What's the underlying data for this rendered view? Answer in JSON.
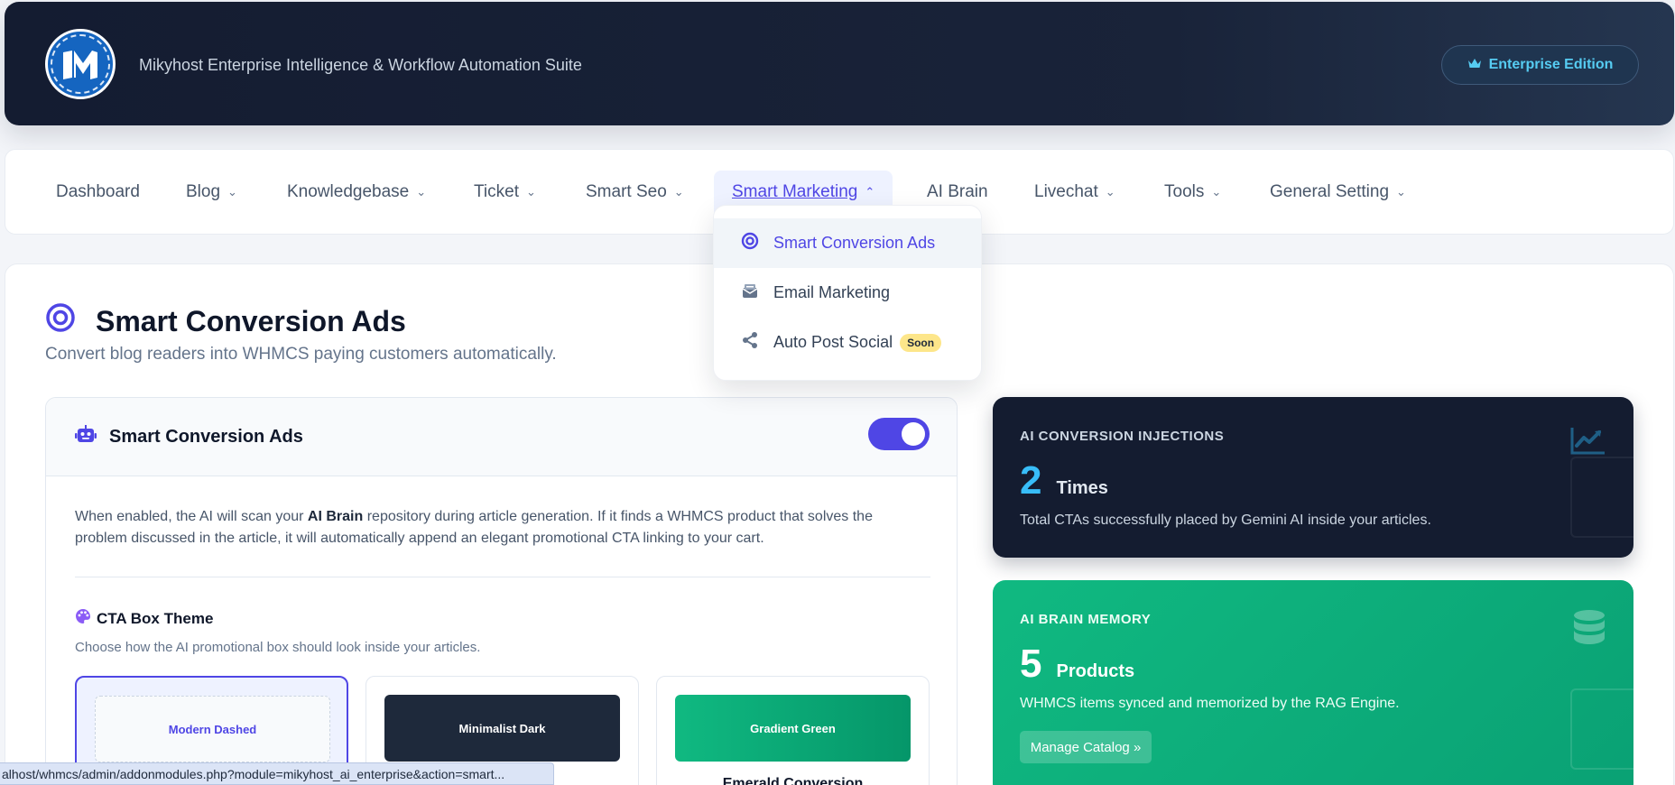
{
  "header": {
    "title": "Mikyhost Enterprise Intelligence & Workflow Automation Suite",
    "edition_label": "Enterprise Edition",
    "logo_icon": "mikyhost-logo",
    "edition_icon": "crown-icon"
  },
  "nav": {
    "items": [
      {
        "label": "Dashboard",
        "has_dropdown": false
      },
      {
        "label": "Blog",
        "has_dropdown": true
      },
      {
        "label": "Knowledgebase",
        "has_dropdown": true
      },
      {
        "label": "Ticket",
        "has_dropdown": true
      },
      {
        "label": "Smart Seo",
        "has_dropdown": true
      },
      {
        "label": "Smart Marketing",
        "has_dropdown": true,
        "active": true
      },
      {
        "label": "AI Brain",
        "has_dropdown": false
      },
      {
        "label": "Livechat",
        "has_dropdown": true
      },
      {
        "label": "Tools",
        "has_dropdown": true
      },
      {
        "label": "General Setting",
        "has_dropdown": true
      }
    ],
    "dropdown": [
      {
        "label": "Smart Conversion Ads",
        "icon": "target-icon",
        "active": true
      },
      {
        "label": "Email Marketing",
        "icon": "mail-bulk-icon"
      },
      {
        "label": "Auto Post Social",
        "icon": "share-icon",
        "badge": "Soon"
      }
    ]
  },
  "page": {
    "title": "Smart Conversion Ads",
    "subtitle": "Convert blog readers into WHMCS paying customers automatically."
  },
  "panel": {
    "title": "Smart Conversion Ads",
    "enabled": true,
    "desc_part1": "When enabled, the AI will scan your ",
    "desc_bold": "AI Brain",
    "desc_part2": " repository during article generation. If it finds a WHMCS product that solves the problem discussed in the article, it will automatically append an elegant promotional CTA linking to your cart.",
    "theme_title": "CTA Box Theme",
    "theme_desc": "Choose how the AI promotional box should look inside your articles.",
    "themes": [
      {
        "preview": "Modern Dashed",
        "name": "",
        "selected": true
      },
      {
        "preview": "Minimalist Dark",
        "name": "",
        "selected": false
      },
      {
        "preview": "Gradient Green",
        "name": "Emerald Conversion",
        "selected": false
      }
    ]
  },
  "stats": {
    "injections": {
      "label": "AI CONVERSION INJECTIONS",
      "value": "2",
      "unit": "Times",
      "desc": "Total CTAs successfully placed by Gemini AI inside your articles.",
      "icon": "chart-line-icon"
    },
    "memory": {
      "label": "AI BRAIN MEMORY",
      "value": "5",
      "unit": "Products",
      "desc": "WHMCS items synced and memorized by the RAG Engine.",
      "button": "Manage Catalog »",
      "icon": "database-icon"
    }
  },
  "statusbar": {
    "url": "alhost/whmcs/admin/addonmodules.php?module=mikyhost_ai_enterprise&action=smart..."
  }
}
